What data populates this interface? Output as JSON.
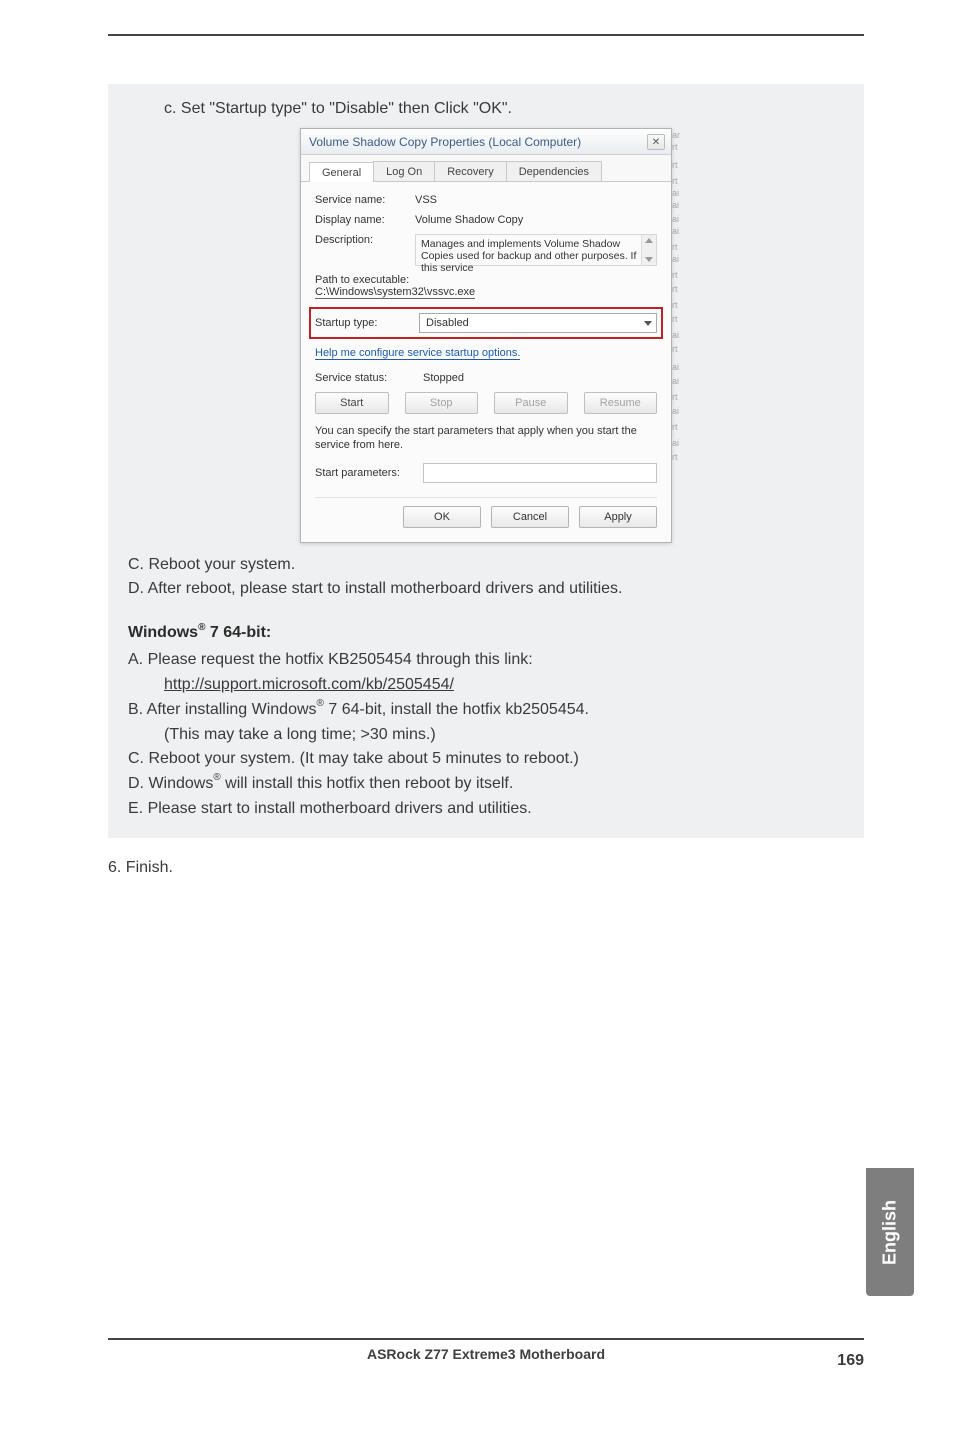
{
  "topInstruction": "c. Set \"Startup type\" to \"Disable\" then Click \"OK\".",
  "dialog": {
    "title": "Volume Shadow Copy Properties (Local Computer)",
    "closeGlyph": "✕",
    "tabs": {
      "general": "General",
      "logon": "Log On",
      "recovery": "Recovery",
      "dependencies": "Dependencies"
    },
    "serviceName": {
      "label": "Service name:",
      "value": "VSS"
    },
    "displayName": {
      "label": "Display name:",
      "value": "Volume Shadow Copy"
    },
    "description": {
      "label": "Description:",
      "value": "Manages and implements Volume Shadow Copies used for backup and other purposes. If this service"
    },
    "pathLabel": "Path to executable:",
    "pathValue": "C:\\Windows\\system32\\vssvc.exe",
    "startupType": {
      "label": "Startup type:",
      "value": "Disabled"
    },
    "helpLink": "Help me configure service startup options.",
    "serviceStatus": {
      "label": "Service status:",
      "value": "Stopped"
    },
    "buttons": {
      "start": "Start",
      "stop": "Stop",
      "pause": "Pause",
      "resume": "Resume"
    },
    "note": "You can specify the start parameters that apply when you start the service from here.",
    "startParamsLabel": "Start parameters:",
    "actions": {
      "ok": "OK",
      "cancel": "Cancel",
      "apply": "Apply"
    }
  },
  "afterDialog": {
    "c": "C. Reboot your system.",
    "d": "D. After reboot, please start to install motherboard drivers and utilities."
  },
  "win7": {
    "heading_pre": "Windows",
    "heading_post": " 7 64-bit:",
    "a1": "A. Please request the hotfix KB2505454 through this link:",
    "a_link": "http://support.microsoft.com/kb/2505454/",
    "b1_pre": "B. After installing Windows",
    "b1_post": " 7 64-bit, install the hotfix kb2505454.",
    "b2": "(This may take a long time; >30 mins.)",
    "c": "C. Reboot your system. (It may take about 5 minutes to reboot.)",
    "d_pre": "D. Windows",
    "d_post": " will install this hotfix then reboot by itself.",
    "e": "E. Please start to install motherboard drivers and utilities."
  },
  "finish": "6. Finish.",
  "sideTab": "English",
  "footer": {
    "title": "ASRock  Z77 Extreme3  Motherboard",
    "page": "169"
  },
  "frag": [
    "ar",
    "rt",
    "rt",
    "rt",
    "ai",
    "ai",
    "ai",
    "ai",
    "rt",
    "ai",
    "rt",
    "rt",
    "rt",
    "rt",
    "ai",
    "rt",
    "ai",
    "ai",
    "rt",
    "ai",
    "rt",
    "ai",
    "rt"
  ]
}
